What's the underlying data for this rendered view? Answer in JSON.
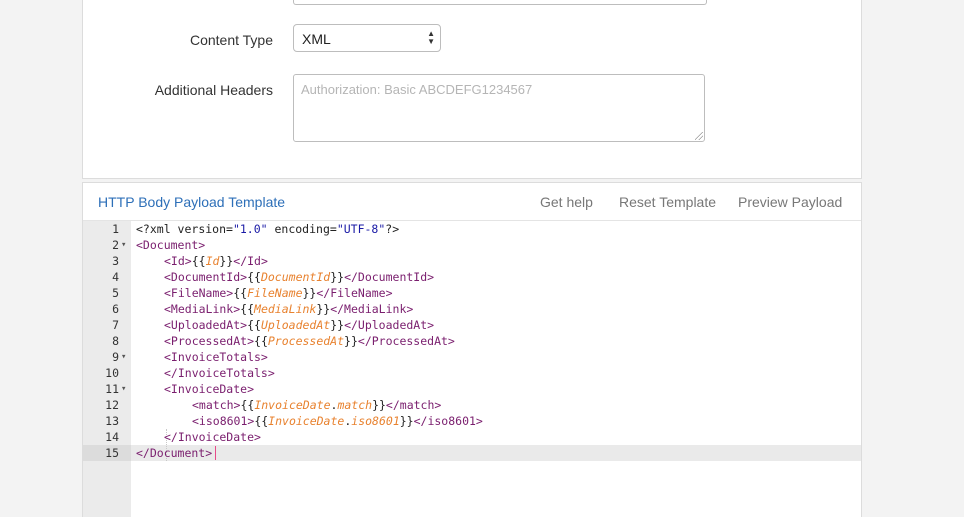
{
  "form": {
    "content_type_label": "Content Type",
    "content_type_value": "XML",
    "additional_headers_label": "Additional Headers",
    "additional_headers_placeholder": "Authorization: Basic ABCDEFG1234567"
  },
  "payload_panel": {
    "title": "HTTP Body Payload Template",
    "get_help": "Get help",
    "reset_template": "Reset Template",
    "preview_payload": "Preview Payload"
  },
  "editor": {
    "active_line": 15,
    "lines": [
      {
        "n": "1",
        "fold": false,
        "indent": 0,
        "tokens": [
          [
            "pi",
            "<?xml "
          ],
          [
            "attr",
            "version="
          ],
          [
            "str",
            "\"1.0\""
          ],
          [
            "attr",
            " encoding="
          ],
          [
            "str",
            "\"UTF-8\""
          ],
          [
            "pi",
            "?>"
          ]
        ]
      },
      {
        "n": "2",
        "fold": true,
        "indent": 0,
        "tokens": [
          [
            "tag",
            "<Document>"
          ]
        ]
      },
      {
        "n": "3",
        "fold": false,
        "indent": 1,
        "tokens": [
          [
            "tag",
            "<Id>"
          ],
          [
            "brace",
            "{{"
          ],
          [
            "var",
            "Id"
          ],
          [
            "brace",
            "}}"
          ],
          [
            "tag",
            "</Id>"
          ]
        ]
      },
      {
        "n": "4",
        "fold": false,
        "indent": 1,
        "tokens": [
          [
            "tag",
            "<DocumentId>"
          ],
          [
            "brace",
            "{{"
          ],
          [
            "var",
            "DocumentId"
          ],
          [
            "brace",
            "}}"
          ],
          [
            "tag",
            "</DocumentId>"
          ]
        ]
      },
      {
        "n": "5",
        "fold": false,
        "indent": 1,
        "tokens": [
          [
            "tag",
            "<FileName>"
          ],
          [
            "brace",
            "{{"
          ],
          [
            "var",
            "FileName"
          ],
          [
            "brace",
            "}}"
          ],
          [
            "tag",
            "</FileName>"
          ]
        ]
      },
      {
        "n": "6",
        "fold": false,
        "indent": 1,
        "tokens": [
          [
            "tag",
            "<MediaLink>"
          ],
          [
            "brace",
            "{{"
          ],
          [
            "var",
            "MediaLink"
          ],
          [
            "brace",
            "}}"
          ],
          [
            "tag",
            "</MediaLink>"
          ]
        ]
      },
      {
        "n": "7",
        "fold": false,
        "indent": 1,
        "tokens": [
          [
            "tag",
            "<UploadedAt>"
          ],
          [
            "brace",
            "{{"
          ],
          [
            "var",
            "UploadedAt"
          ],
          [
            "brace",
            "}}"
          ],
          [
            "tag",
            "</UploadedAt>"
          ]
        ]
      },
      {
        "n": "8",
        "fold": false,
        "indent": 1,
        "tokens": [
          [
            "tag",
            "<ProcessedAt>"
          ],
          [
            "brace",
            "{{"
          ],
          [
            "var",
            "ProcessedAt"
          ],
          [
            "brace",
            "}}"
          ],
          [
            "tag",
            "</ProcessedAt>"
          ]
        ]
      },
      {
        "n": "9",
        "fold": true,
        "indent": 1,
        "tokens": [
          [
            "tag",
            "<InvoiceTotals>"
          ]
        ]
      },
      {
        "n": "10",
        "fold": false,
        "indent": 1,
        "tokens": [
          [
            "tag",
            "</InvoiceTotals>"
          ]
        ]
      },
      {
        "n": "11",
        "fold": true,
        "indent": 1,
        "tokens": [
          [
            "tag",
            "<InvoiceDate>"
          ]
        ]
      },
      {
        "n": "12",
        "fold": false,
        "indent": 2,
        "tokens": [
          [
            "tag",
            "<match>"
          ],
          [
            "brace",
            "{{"
          ],
          [
            "var",
            "InvoiceDate"
          ],
          [
            "brace",
            "."
          ],
          [
            "var",
            "match"
          ],
          [
            "brace",
            "}}"
          ],
          [
            "tag",
            "</match>"
          ]
        ]
      },
      {
        "n": "13",
        "fold": false,
        "indent": 2,
        "tokens": [
          [
            "tag",
            "<iso8601>"
          ],
          [
            "brace",
            "{{"
          ],
          [
            "var",
            "InvoiceDate"
          ],
          [
            "brace",
            "."
          ],
          [
            "var",
            "iso8601"
          ],
          [
            "brace",
            "}}"
          ],
          [
            "tag",
            "</iso8601>"
          ]
        ]
      },
      {
        "n": "14",
        "fold": false,
        "indent": 1,
        "tokens": [
          [
            "tag",
            "</InvoiceDate>"
          ]
        ]
      },
      {
        "n": "15",
        "fold": false,
        "indent": 0,
        "tokens": [
          [
            "tag",
            "</Document>"
          ]
        ]
      }
    ]
  }
}
